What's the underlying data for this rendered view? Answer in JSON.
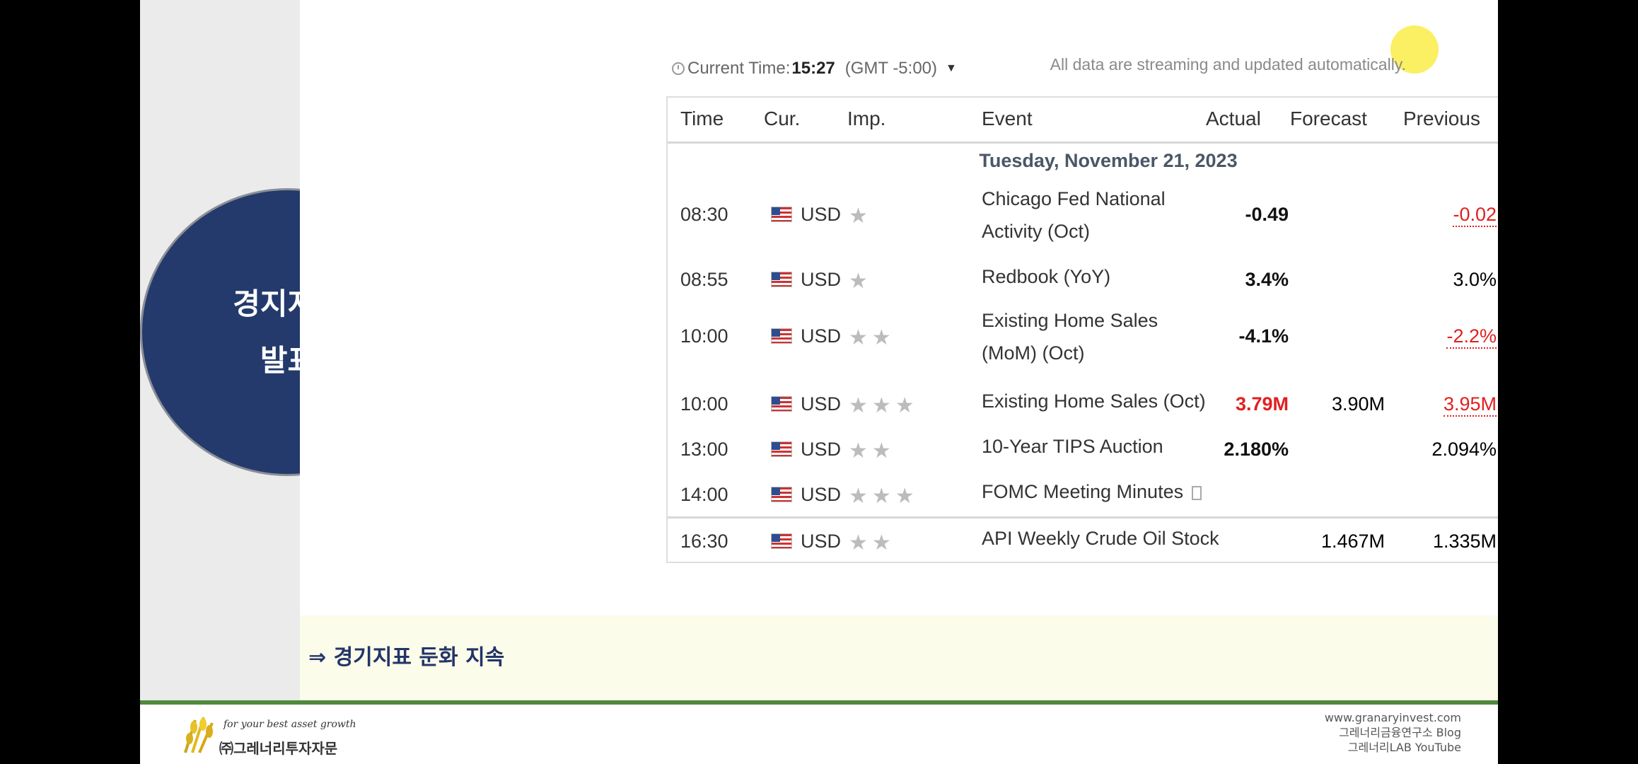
{
  "circle": {
    "line1": "경지지표",
    "line2": "발표"
  },
  "calendar": {
    "current_time_label": "Current Time:",
    "current_time": "15:27",
    "timezone": "(GMT -5:00)",
    "streaming_note": "All data are streaming and updated automatically.",
    "headers": {
      "time": "Time",
      "cur": "Cur.",
      "imp": "Imp.",
      "event": "Event",
      "actual": "Actual",
      "forecast": "Forecast",
      "previous": "Previous"
    },
    "date": "Tuesday, November 21, 2023",
    "rows": [
      {
        "time": "08:30",
        "cur": "USD",
        "stars": "★",
        "event": "Chicago Fed National Activity (Oct)",
        "actual": "-0.49",
        "forecast": "",
        "previous": "-0.02"
      },
      {
        "time": "08:55",
        "cur": "USD",
        "stars": "★",
        "event": "Redbook (YoY)",
        "actual": "3.4%",
        "forecast": "",
        "previous": "3.0%"
      },
      {
        "time": "10:00",
        "cur": "USD",
        "stars": "★★",
        "event": "Existing Home Sales (MoM) (Oct)",
        "actual": "-4.1%",
        "forecast": "",
        "previous": "-2.2%"
      },
      {
        "time": "10:00",
        "cur": "USD",
        "stars": "★★★",
        "event": "Existing Home Sales (Oct)",
        "actual": "3.79M",
        "forecast": "3.90M",
        "previous": "3.95M"
      },
      {
        "time": "13:00",
        "cur": "USD",
        "stars": "★★",
        "event": "10-Year TIPS Auction",
        "actual": "2.180%",
        "forecast": "",
        "previous": "2.094%"
      },
      {
        "time": "14:00",
        "cur": "USD",
        "stars": "★★★",
        "event": "FOMC Meeting Minutes",
        "actual": "",
        "forecast": "",
        "previous": ""
      },
      {
        "time": "16:30",
        "cur": "USD",
        "stars": "★★",
        "event": "API Weekly Crude Oil Stock",
        "actual": "",
        "forecast": "1.467M",
        "previous": "1.335M"
      }
    ]
  },
  "note": "⇒ 경기지표 둔화 지속",
  "footer": {
    "slogan": "for your best asset growth",
    "company": "㈜그레너리투자자문",
    "url": "www.granaryinvest.com",
    "blog": "그레너리금융연구소 Blog",
    "youtube": "그레너리LAB YouTube"
  },
  "colors": {
    "circle": "#243a6c",
    "note_text": "#23346a",
    "note_band": "#fbfce9",
    "green_line": "#4f8a3d",
    "negative": "#e02020"
  }
}
